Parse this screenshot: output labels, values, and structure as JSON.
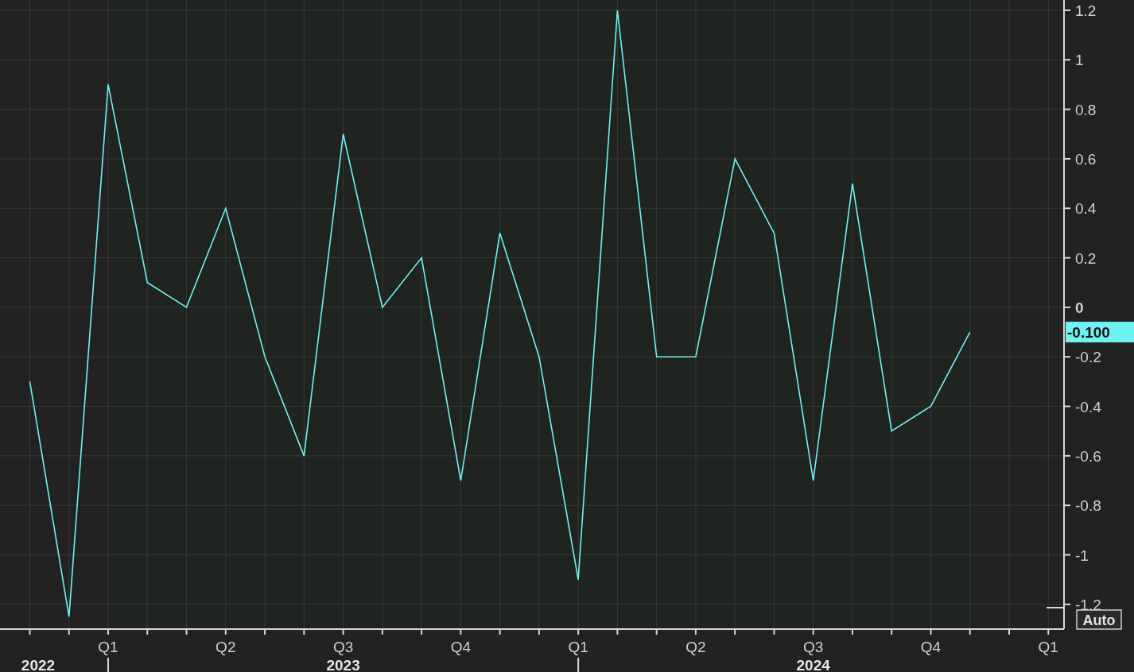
{
  "chart": {
    "chart_data": {
      "type": "line",
      "grid": true,
      "categories": [
        null,
        null,
        "Q1",
        null,
        null,
        "Q2",
        null,
        null,
        "Q3",
        null,
        null,
        "Q4",
        null,
        null,
        "Q1",
        null,
        null,
        "Q2",
        null,
        null,
        "Q3",
        null,
        null,
        "Q4",
        null,
        null,
        "Q1"
      ],
      "series": [
        {
          "color": "#6ff2f2",
          "values": [
            -0.3,
            -1.25,
            0.9,
            0.1,
            0.0,
            0.4,
            -0.2,
            -0.6,
            0.7,
            0.0,
            0.2,
            -0.7,
            0.3,
            -0.2,
            -1.1,
            1.2,
            -0.2,
            -0.2,
            0.6,
            0.3,
            -0.7,
            0.5,
            -0.5,
            -0.4,
            -0.1,
            null,
            null
          ]
        }
      ],
      "ylim": [
        -1.3,
        1.2416
      ],
      "yticks": [
        1.2,
        1,
        0.8,
        0.6,
        0.4,
        0.2,
        0,
        -0.2,
        -0.4,
        -0.6,
        -0.8,
        -1,
        -1.2
      ]
    },
    "year_labels": [
      "2022",
      "2023",
      "2024"
    ],
    "last_value_label": "-0.100",
    "auto_button": "Auto"
  }
}
